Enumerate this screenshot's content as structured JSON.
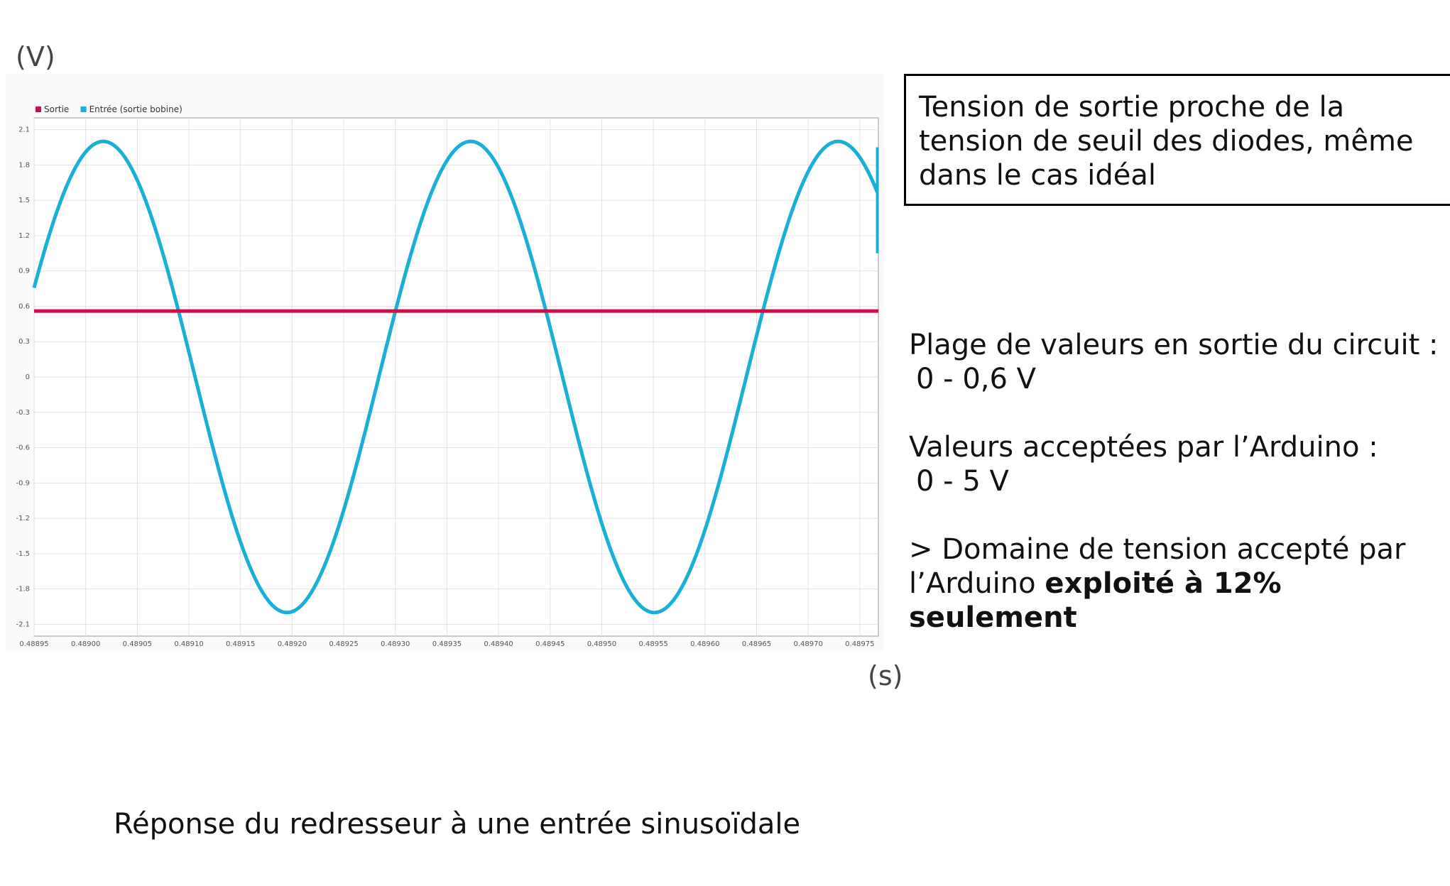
{
  "colors": {
    "output": "#c8134a",
    "input": "#1ab0d6"
  },
  "unit_y": "(V)",
  "unit_x": "(s)",
  "note_box": "Tension de sortie proche de la tension de seuil des diodes, même dans le cas idéal",
  "info": {
    "range_label": "Plage de valeurs en sortie du circuit :",
    "range_value": "0 - 0,6 V",
    "accepted_label": "Valeurs acceptées par l’Arduino :",
    "accepted_value": "0 - 5 V",
    "conclusion_prefix": "> Domaine de tension accepté par l’Arduino ",
    "conclusion_bold": "exploité à 12% seulement"
  },
  "caption": "Réponse du redresseur à une entrée sinusoïdale",
  "chart_data": {
    "type": "line",
    "title": "",
    "xlabel": "(s)",
    "ylabel": "(V)",
    "legend_position": "top-left",
    "grid": true,
    "xlim": [
      0.48895,
      0.489768
    ],
    "ylim": [
      -2.2,
      2.2
    ],
    "xticks": [
      0.48895,
      0.489,
      0.48905,
      0.4891,
      0.48915,
      0.4892,
      0.48925,
      0.4893,
      0.48935,
      0.4894,
      0.48945,
      0.4895,
      0.48955,
      0.4896,
      0.48965,
      0.4897,
      0.48975
    ],
    "xtick_labels": [
      "0.48895",
      "0.48900",
      "0.48905",
      "0.48910",
      "0.48915",
      "0.48920",
      "0.48925",
      "0.48930",
      "0.48935",
      "0.48940",
      "0.48945",
      "0.48950",
      "0.48955",
      "0.48960",
      "0.48965",
      "0.48970",
      "0.48975"
    ],
    "yticks": [
      2.1,
      1.8,
      1.5,
      1.2,
      0.9,
      0.6,
      0.3,
      0,
      -0.3,
      -0.6,
      -0.9,
      -1.2,
      -1.5,
      -1.8,
      -2.1
    ],
    "ytick_labels": [
      "2.1",
      "1.8",
      "1.5",
      "1.2",
      "0.9",
      "0.6",
      "0.3",
      "0",
      "-0.3",
      "-0.6",
      "-0.9",
      "-1.2",
      "-1.5",
      "-1.8",
      "-2.1"
    ],
    "series": [
      {
        "name": "Sortie",
        "color": "#c8134a",
        "x": [
          0.48895,
          0.489768
        ],
        "y": [
          0.56,
          0.56
        ]
      },
      {
        "name": "Entrée (sortie bobine)",
        "color": "#1ab0d6",
        "waveform": "sine",
        "amplitude": 2.0,
        "period": 0.000356,
        "peak_time": 0.489017,
        "x_end_discontinuity": 0.489767,
        "y_end_values": [
          1.95,
          1.05
        ]
      }
    ]
  }
}
